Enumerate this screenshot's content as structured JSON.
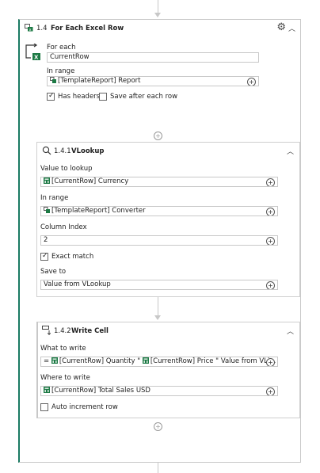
{
  "top_action": {
    "number": "1.4",
    "title": "For Each Excel Row",
    "for_each_label": "For each",
    "for_each_value": "CurrentRow",
    "in_range_label": "In range",
    "in_range_value": "[TemplateReport] Report",
    "has_headers_label": "Has headers",
    "has_headers_checked": true,
    "save_after_label": "Save after each row",
    "save_after_checked": false
  },
  "vlookup": {
    "number": "1.4.1",
    "title": "VLookup",
    "value_label": "Value to lookup",
    "value": "[CurrentRow] Currency",
    "range_label": "In range",
    "range": "[TemplateReport] Converter",
    "column_label": "Column Index",
    "column": "2",
    "exact_label": "Exact match",
    "exact_checked": true,
    "save_label": "Save to",
    "save": "Value from VLookup"
  },
  "write_cell": {
    "number": "1.4.2",
    "title": "Write Cell",
    "what_label": "What to write",
    "what_prefix": "=",
    "what_part1": "[CurrentRow] Quantity \"",
    "what_part2": "[CurrentRow] Price \"",
    "what_part3": "Value from VLi...",
    "where_label": "Where to write",
    "where": "[CurrentRow] Total Sales USD",
    "auto_label": "Auto increment row",
    "auto_checked": false
  }
}
